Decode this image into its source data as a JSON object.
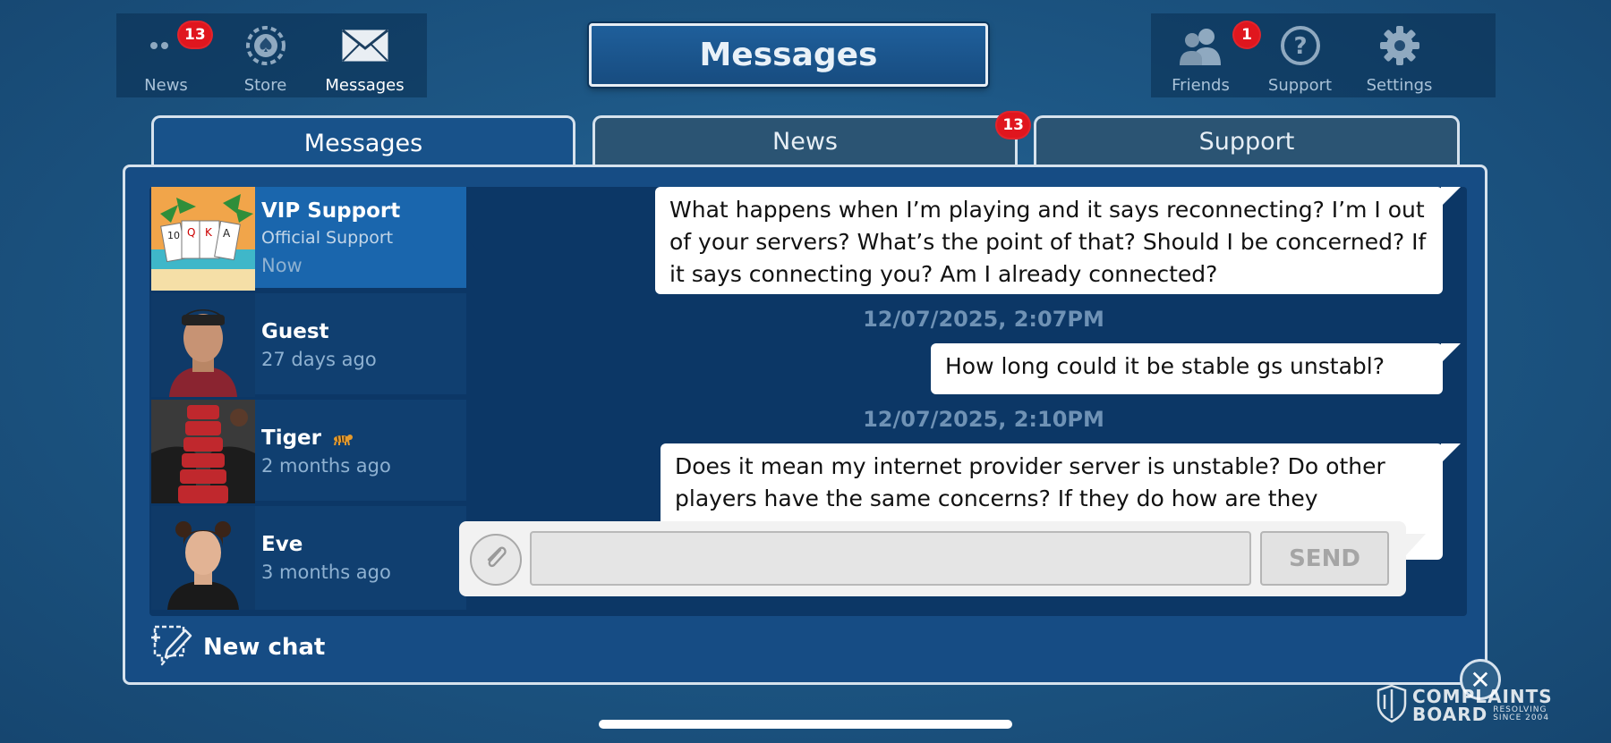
{
  "nav_left": {
    "items": [
      {
        "label": "News",
        "icon": "dots-icon",
        "badge": "13"
      },
      {
        "label": "Store",
        "icon": "spade-chip-icon"
      },
      {
        "label": "Messages",
        "icon": "envelope-icon"
      }
    ]
  },
  "title": "Messages",
  "nav_right": {
    "items": [
      {
        "label": "Friends",
        "icon": "friends-icon",
        "badge": "1"
      },
      {
        "label": "Support",
        "icon": "question-icon"
      },
      {
        "label": "Settings",
        "icon": "gear-icon"
      }
    ]
  },
  "tabs": [
    {
      "label": "Messages",
      "active": true
    },
    {
      "label": "News",
      "badge": "13"
    },
    {
      "label": "Support"
    }
  ],
  "contacts": [
    {
      "name": "VIP Support",
      "subtitle": "Official Support",
      "time": "Now",
      "active": true
    },
    {
      "name": "Guest",
      "time": "27 days ago"
    },
    {
      "name": "Tiger",
      "time": "2 months ago"
    },
    {
      "name": "Eve",
      "time": "3 months ago"
    }
  ],
  "chat": {
    "messages": [
      {
        "text": "What happens when I’m playing and it says reconnecting? I’m I out of your servers? What’s the point of that? Should I be concerned? If it says connecting you? Am I already connected?"
      },
      {
        "stamp": "12/07/2025, 2:07PM"
      },
      {
        "text": "How long could it be stable gs unstabl?"
      },
      {
        "stamp": "12/07/2025, 2:10PM"
      },
      {
        "text": "Does it mean my internet provider server is unstable? Do other players have the same concerns? If they do how are they resolved?"
      }
    ]
  },
  "input": {
    "value": "",
    "send_label": "SEND"
  },
  "new_chat_label": "New chat",
  "close_symbol": "✕",
  "watermark": {
    "line1": "COMPLAINTS",
    "line2": "BOARD",
    "tag1": "RESOLVING",
    "tag2": "SINCE 2004"
  },
  "colors": {
    "accent": "#1a66ad",
    "badge": "#e0161e",
    "panel": "#164c84"
  }
}
